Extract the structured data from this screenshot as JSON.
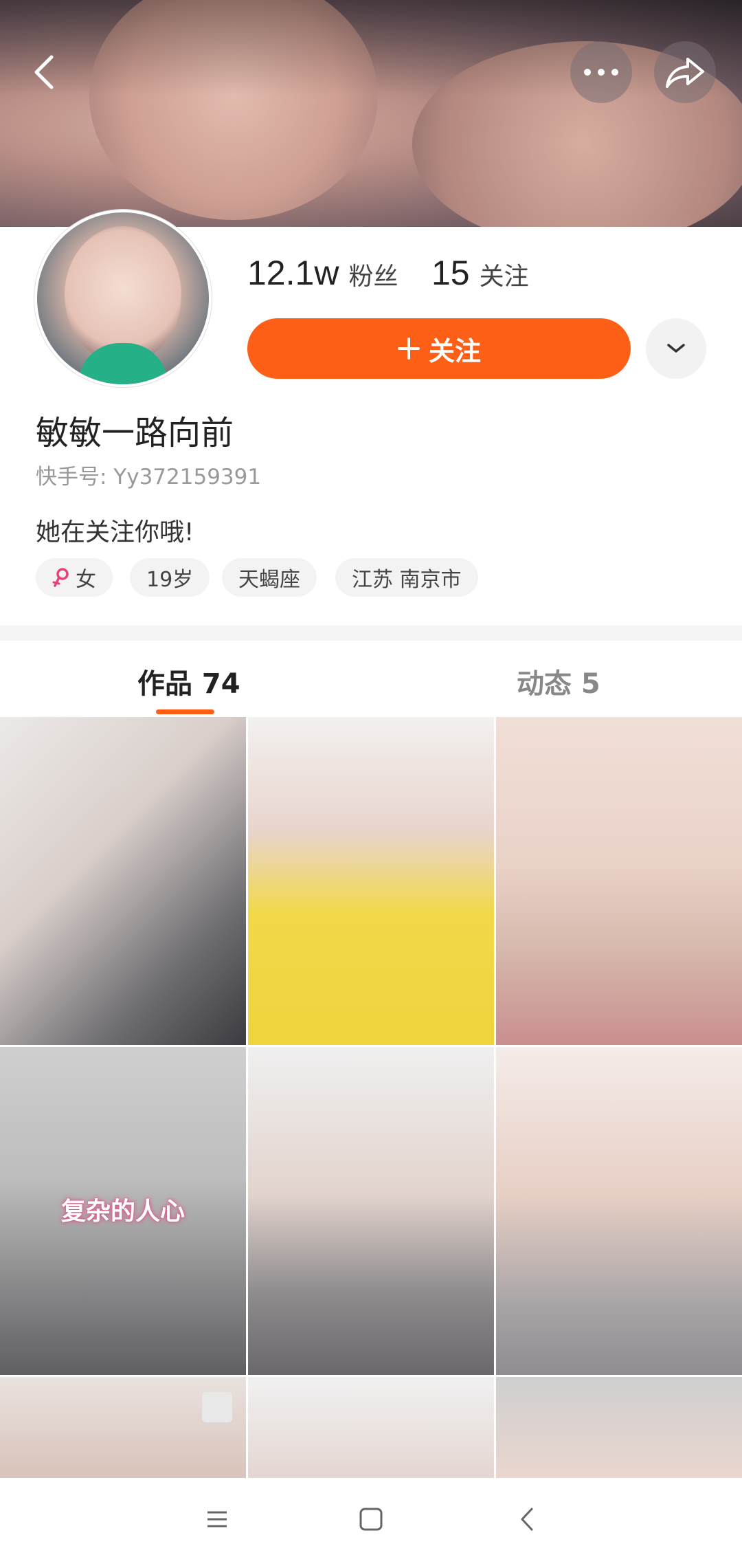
{
  "profile": {
    "fans_count": "12.1w",
    "fans_label": "粉丝",
    "following_count": "15",
    "following_label": "关注",
    "follow_button_label": "关注",
    "nickname": "敏敏一路向前",
    "kuaishou_id": "快手号: Yy372159391",
    "follow_status": "她在关注你哦!",
    "tags": [
      {
        "label": "女",
        "icon": "female-icon"
      },
      {
        "label": "19岁"
      },
      {
        "label": "天蝎座"
      },
      {
        "label": "江苏 南京市"
      }
    ]
  },
  "tabs": [
    {
      "label": "作品 74",
      "active": true
    },
    {
      "label": "动态 5",
      "active": false
    }
  ],
  "grid": [
    {
      "overlay_text": ""
    },
    {
      "overlay_text": ""
    },
    {
      "overlay_text": ""
    },
    {
      "overlay_text": "复杂的人心"
    },
    {
      "overlay_text": ""
    },
    {
      "overlay_text": ""
    },
    {
      "overlay_text": ""
    },
    {
      "overlay_text": ""
    },
    {
      "overlay_text": ""
    }
  ],
  "colors": {
    "accent": "#fe5f17",
    "female": "#e8407a"
  },
  "icons": [
    "back-icon",
    "more-icon",
    "share-icon",
    "chevron-down-icon",
    "plus-icon",
    "menu-icon",
    "home-icon",
    "nav-back-icon"
  ]
}
